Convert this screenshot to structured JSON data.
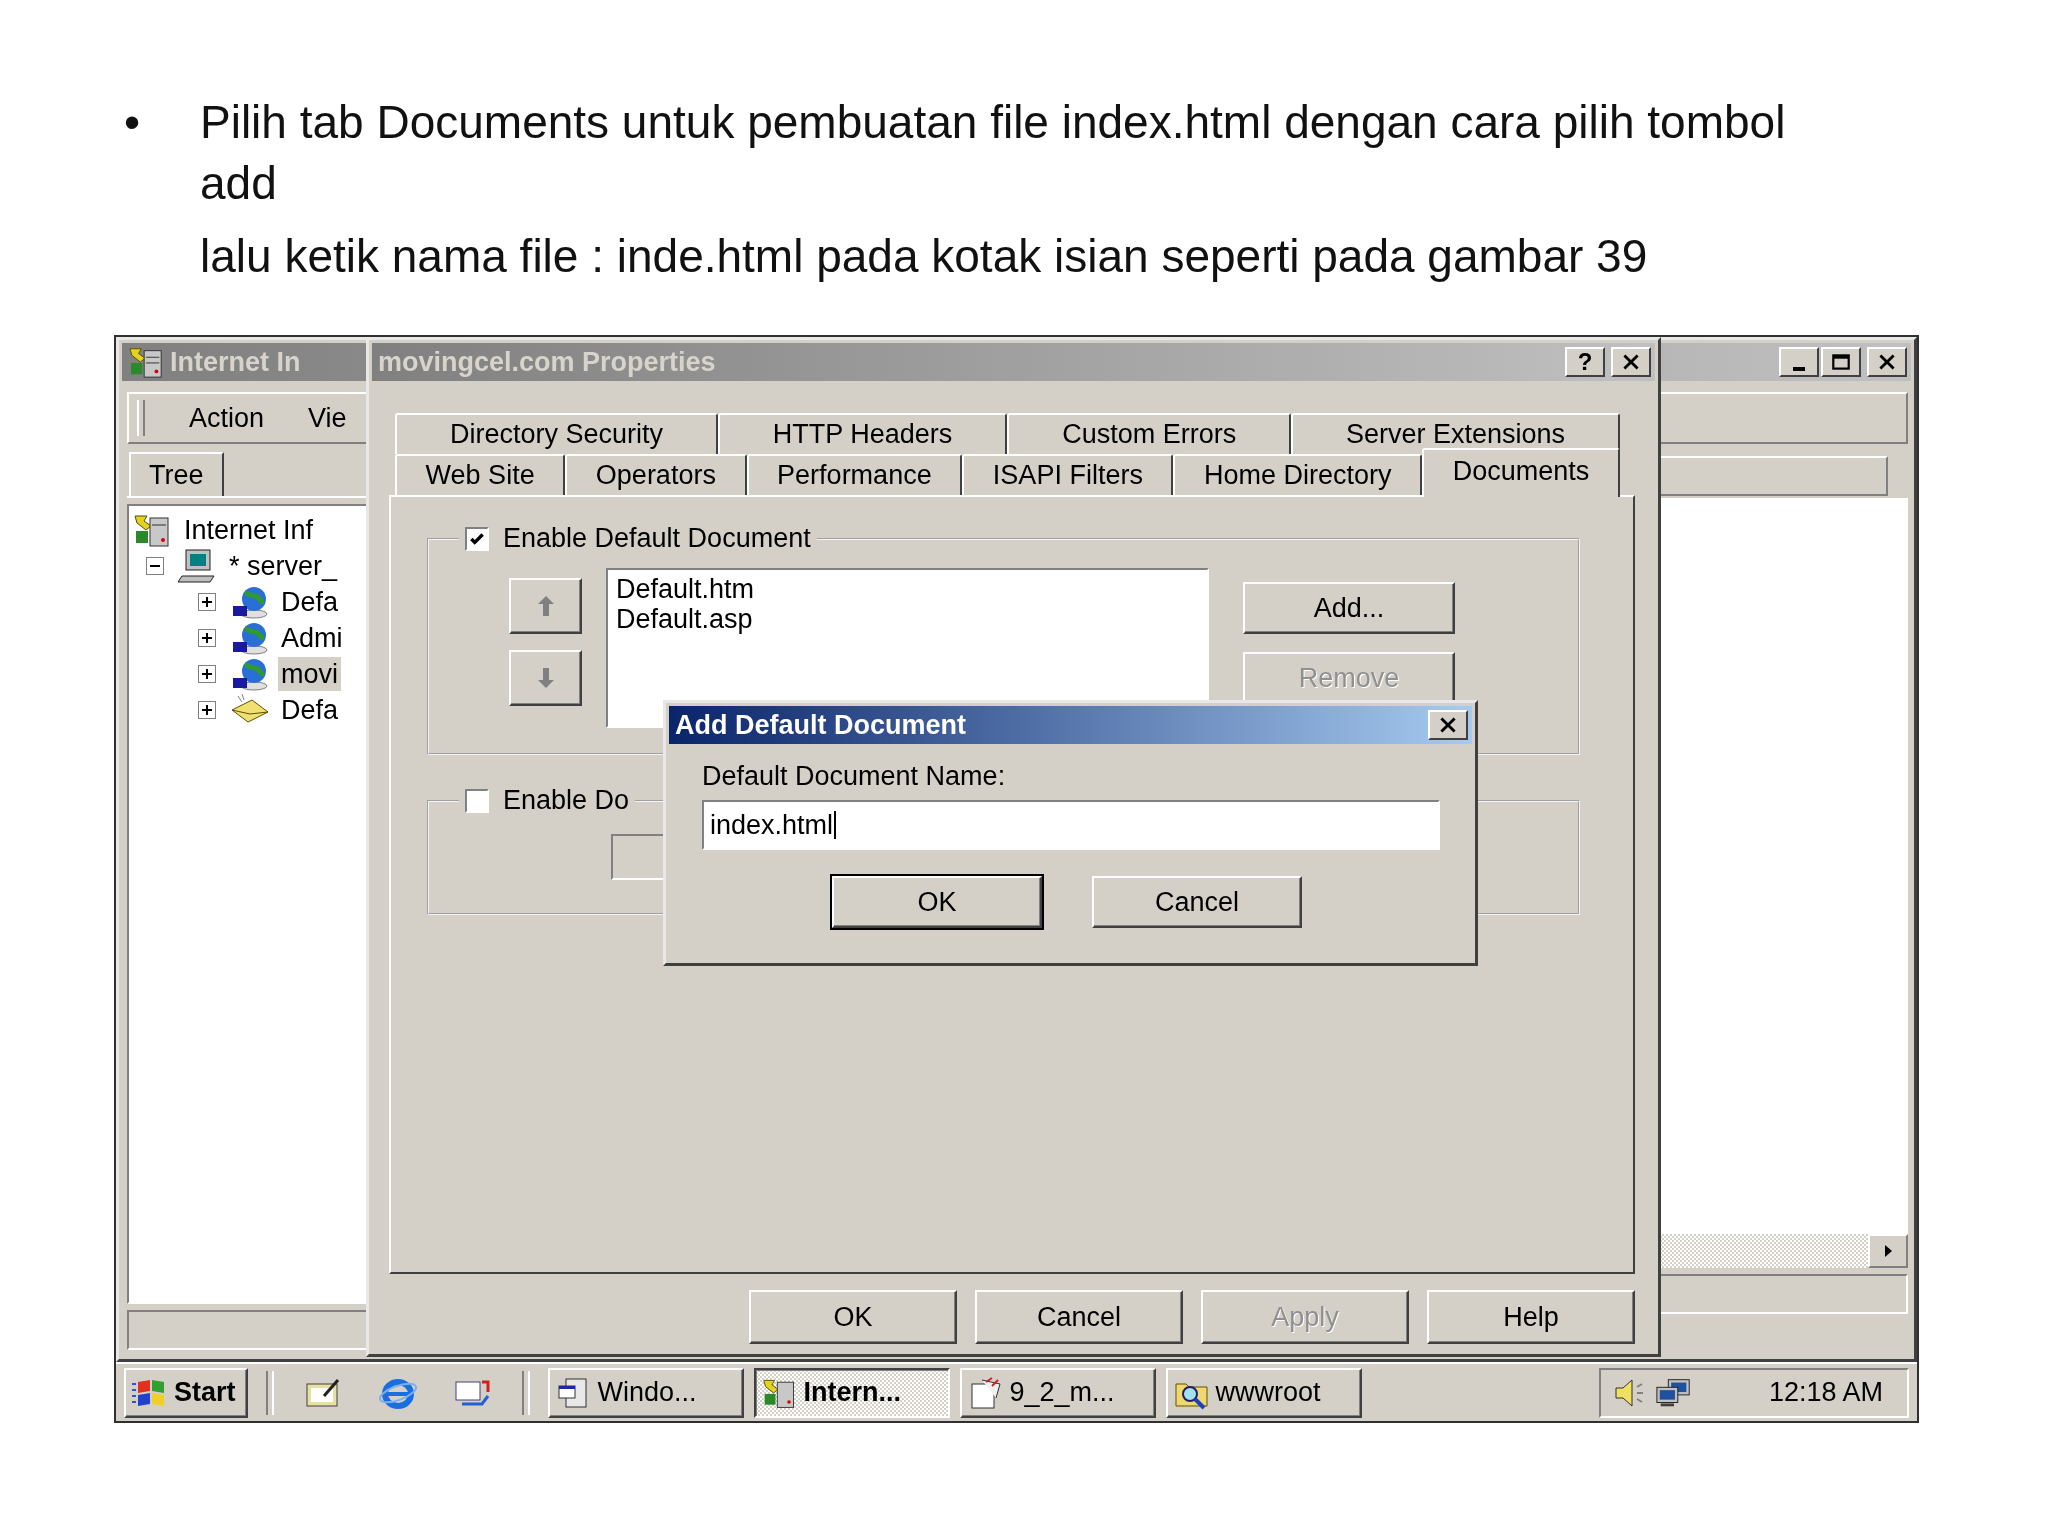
{
  "slide": {
    "bullet": "•",
    "paragraphs": [
      "Pilih tab Documents untuk pembuatan file index.html dengan cara pilih tombol add",
      "lalu ketik nama file : inde.html pada kotak isian seperti pada gambar 39"
    ]
  },
  "mmc": {
    "title": "Internet In",
    "active": false,
    "menu": [
      "Action",
      "Vie"
    ],
    "tree_tab": "Tree",
    "tree": [
      {
        "label": "Internet Inf",
        "kind": "root",
        "selected": false,
        "children": [
          {
            "label": "* server_",
            "kind": "computer",
            "expanded": true,
            "selected": false,
            "children": [
              {
                "label": "Defa",
                "kind": "web-site",
                "expanded": false,
                "selected": false
              },
              {
                "label": "Admi",
                "kind": "web-site",
                "expanded": false,
                "selected": false
              },
              {
                "label": "movi",
                "kind": "web-site",
                "expanded": false,
                "selected": true
              },
              {
                "label": "Defa",
                "kind": "mail",
                "expanded": false,
                "selected": false
              }
            ]
          }
        ]
      }
    ]
  },
  "properties": {
    "title": "movingcel.com Properties",
    "active": false,
    "help": "?",
    "tab_rows": [
      [
        {
          "label": "Directory Security",
          "selected": false
        },
        {
          "label": "HTTP Headers",
          "selected": false
        },
        {
          "label": "Custom Errors",
          "selected": false
        },
        {
          "label": "Server Extensions",
          "selected": false
        }
      ],
      [
        {
          "label": "Web Site",
          "selected": false
        },
        {
          "label": "Operators",
          "selected": false
        },
        {
          "label": "Performance",
          "selected": false
        },
        {
          "label": "ISAPI Filters",
          "selected": false
        },
        {
          "label": "Home Directory",
          "selected": false
        },
        {
          "label": "Documents",
          "selected": true
        }
      ]
    ],
    "default_document": {
      "label": "Enable Default Document",
      "checked": true,
      "move_buttons": [
        {
          "kind": "up",
          "disabled": true
        },
        {
          "kind": "down",
          "disabled": true
        }
      ],
      "documents": [
        "Default.htm",
        "Default.asp"
      ],
      "buttons": [
        {
          "label": "Add...",
          "disabled": false
        },
        {
          "label": "Remove",
          "disabled": true
        }
      ]
    },
    "footer": {
      "label": "Enable Do",
      "checked": false
    },
    "buttons": [
      {
        "label": "OK",
        "disabled": false
      },
      {
        "label": "Cancel",
        "disabled": false
      },
      {
        "label": "Apply",
        "disabled": true
      },
      {
        "label": "Help",
        "disabled": false
      }
    ]
  },
  "add_dialog": {
    "title": "Add Default Document",
    "active": true,
    "field_label": "Default Document Name:",
    "value": "index.html",
    "buttons": [
      {
        "label": "OK",
        "default": true
      },
      {
        "label": "Cancel",
        "default": false
      }
    ]
  },
  "taskbar": {
    "start": "Start",
    "tasks": [
      {
        "label": "Windo...",
        "kind": "window",
        "selected": false
      },
      {
        "label": "Intern...",
        "kind": "mmc",
        "selected": true
      },
      {
        "label": "9_2_m...",
        "kind": "document",
        "selected": false
      },
      {
        "label": "wwwroot",
        "kind": "explorer",
        "selected": false
      }
    ],
    "clock": "12:18 AM"
  }
}
